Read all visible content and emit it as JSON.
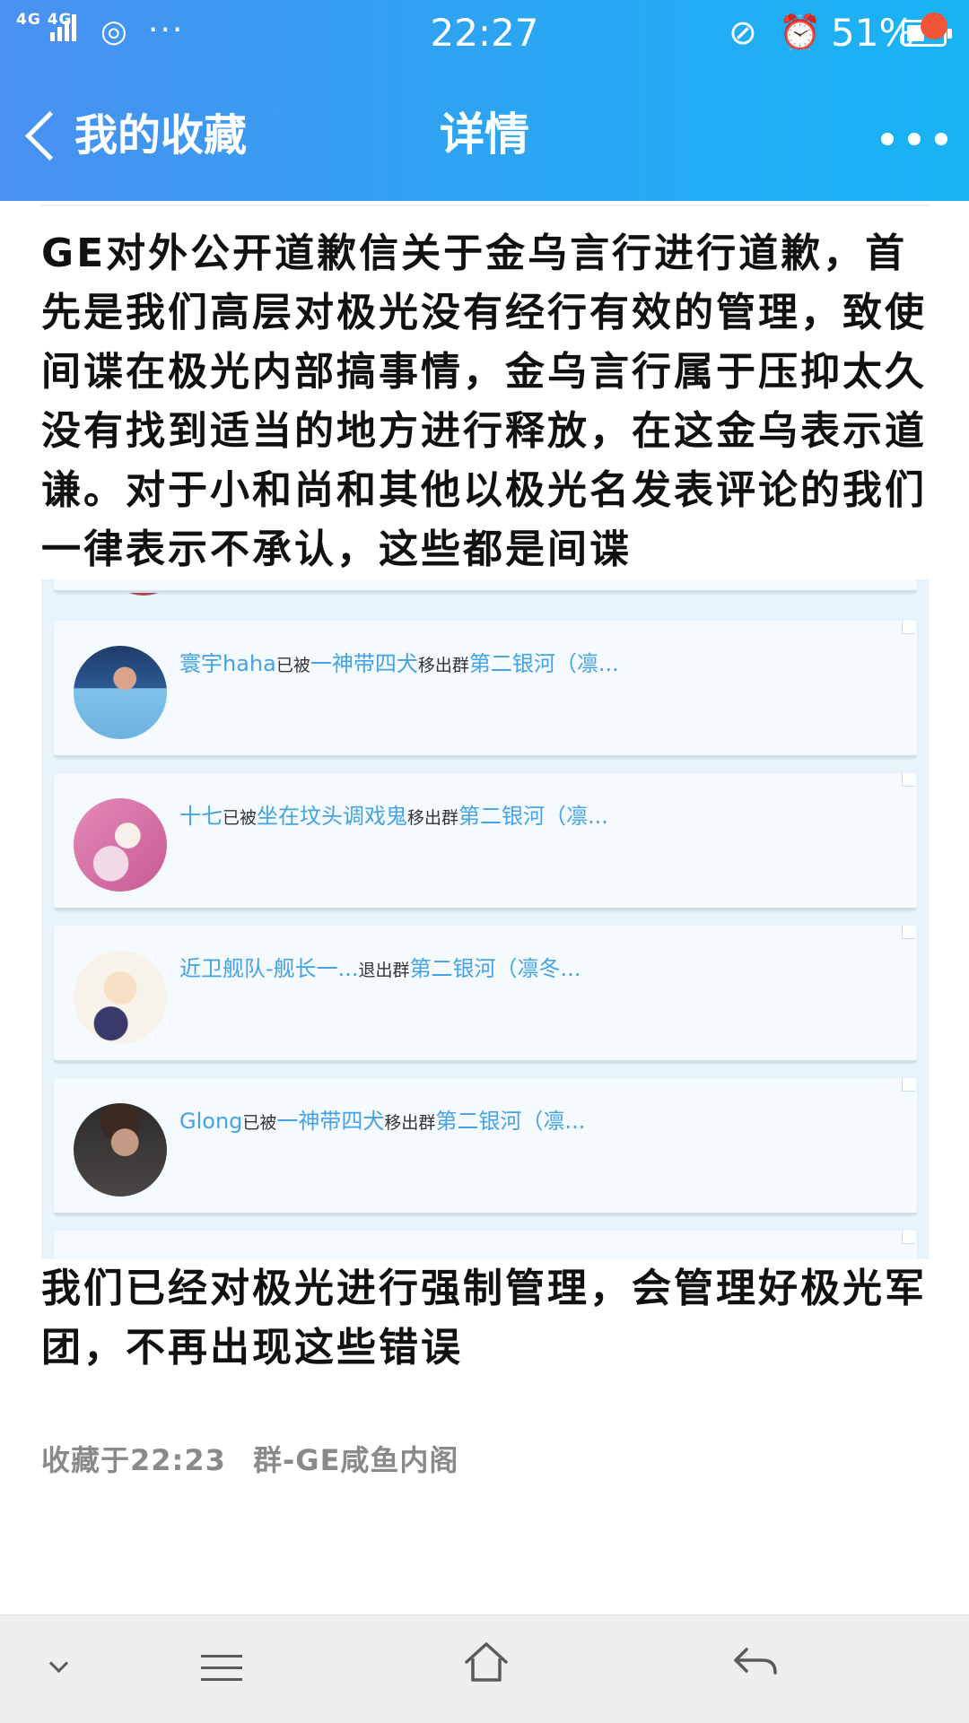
{
  "status_bar": {
    "network": "4G 4G",
    "time": "22:27",
    "battery": "51%",
    "battery_level": 0.51,
    "icons": [
      "signal-icon",
      "carrier-icon",
      "more-dots-icon",
      "mute-icon",
      "alarm-icon",
      "battery-icon"
    ]
  },
  "nav": {
    "back_label": "我的收藏",
    "title": "详情",
    "more_icon": "more-icon",
    "has_notification": true
  },
  "content": {
    "paragraph1": "GE对外公开道歉信关于金乌言行进行道歉，首先是我们高层对极光没有经行有效的管理，致使间谍在极光内部搞事情，金乌言行属于压抑太久没有找到适当的地方进行释放，在这金乌表示道谦。对于小和尚和其他以极光名发表评论的我们一律表示不承认，这些都是间谍",
    "paragraph2": "我们已经对极光进行强制管理，会管理好极光军团，不再出现这些错误"
  },
  "embedded_screenshot": {
    "items": [
      {
        "user": "寰宇haha",
        "verb1": "已被",
        "actor": "一神带四犬",
        "verb2": "移出群",
        "group": "第二银河（凛..."
      },
      {
        "user": "十七",
        "verb1": "已被",
        "actor": "坐在坟头调戏鬼",
        "verb2": "移出群",
        "group": "第二银河（凛..."
      },
      {
        "user": "近卫舰队-舰长一...",
        "verb1": "",
        "actor": "",
        "verb2": "退出群",
        "group": "第二银河（凛冬..."
      },
      {
        "user": "Glong",
        "verb1": "已被",
        "actor": "一神带四犬",
        "verb2": "移出群",
        "group": "第二银河（凛..."
      }
    ]
  },
  "meta": {
    "saved_time": "收藏于22:23",
    "source": "群-GE咸鱼内阁"
  },
  "bottom_bar": {
    "icons": [
      "chevron-down-icon",
      "menu-icon",
      "home-icon",
      "reply-icon"
    ]
  },
  "colors": {
    "header_gradient_start": "#4a90f2",
    "header_gradient_end": "#18b4f4",
    "link_blue": "#45a3e5",
    "notification_red": "#f2553a"
  }
}
